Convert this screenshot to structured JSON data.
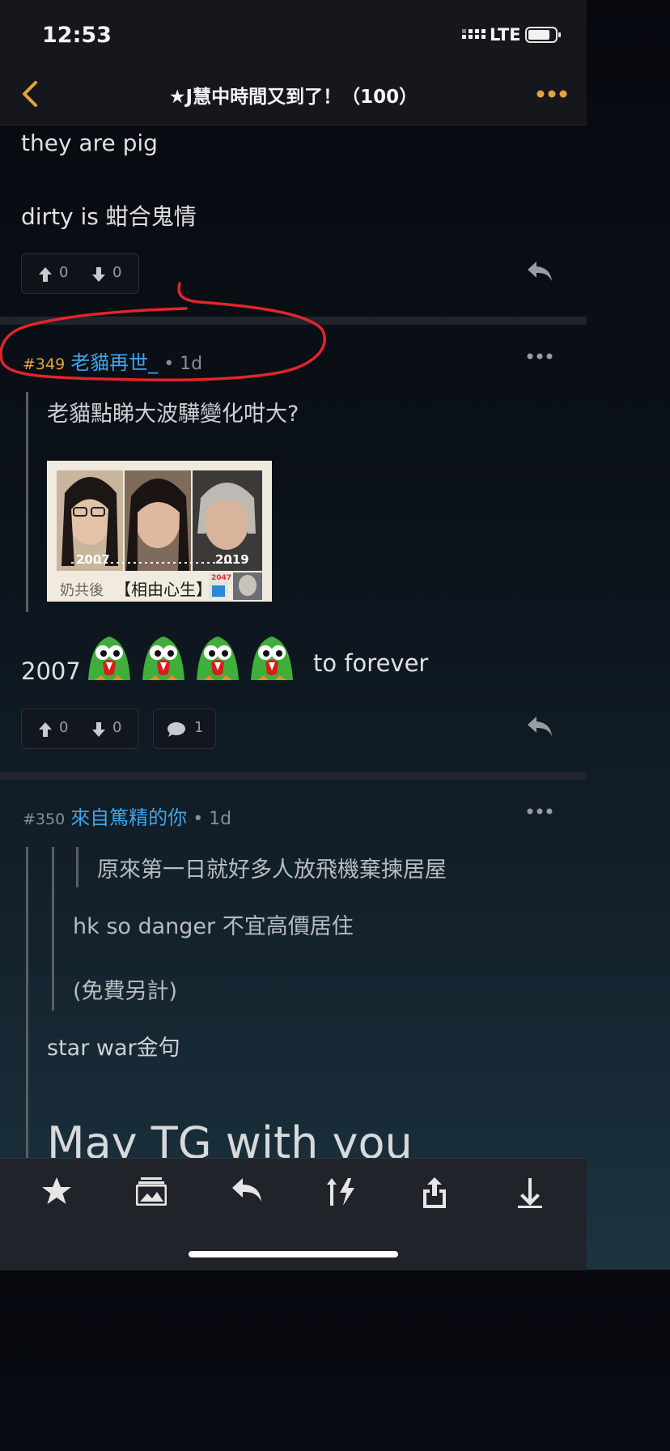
{
  "status_bar": {
    "time": "12:53",
    "network": "LTE"
  },
  "nav": {
    "title": "★J慧中時間又到了！（100）"
  },
  "post_prev": {
    "lines": [
      "they are pig",
      "dirty is 蚶合鬼情"
    ],
    "upvotes": "0",
    "downvotes": "0"
  },
  "post_349": {
    "number": "#349",
    "username": "老貓再世_",
    "time": "• 1d",
    "quote": "老貓點睇大波驊變化咁大?",
    "image": {
      "year_left": "2007",
      "year_right": "2019",
      "caption_left": "奶共後",
      "caption_main": "【相由心生】",
      "badge_top": "2047"
    },
    "text_start": "2007",
    "text_end": "to forever",
    "upvotes": "0",
    "downvotes": "0",
    "comments": "1"
  },
  "post_350": {
    "number": "#350",
    "username": "來自篤精的你",
    "time": "• 1d",
    "nested_quote": "原來第一日就好多人放飛機棄揀居屋",
    "quote_lines": [
      "hk so danger 不宜高價居住",
      "(免費另計)"
    ],
    "text": "star war金句",
    "big_text": "May TG with you"
  },
  "colors": {
    "accent_gold": "#e6a33b",
    "username_blue": "#3fa5ea",
    "annotation_red": "#e0262a"
  },
  "toolbar": {
    "icons": [
      "star-icon",
      "image-icon",
      "reply-icon",
      "sort-icon",
      "share-icon",
      "download-icon"
    ]
  }
}
